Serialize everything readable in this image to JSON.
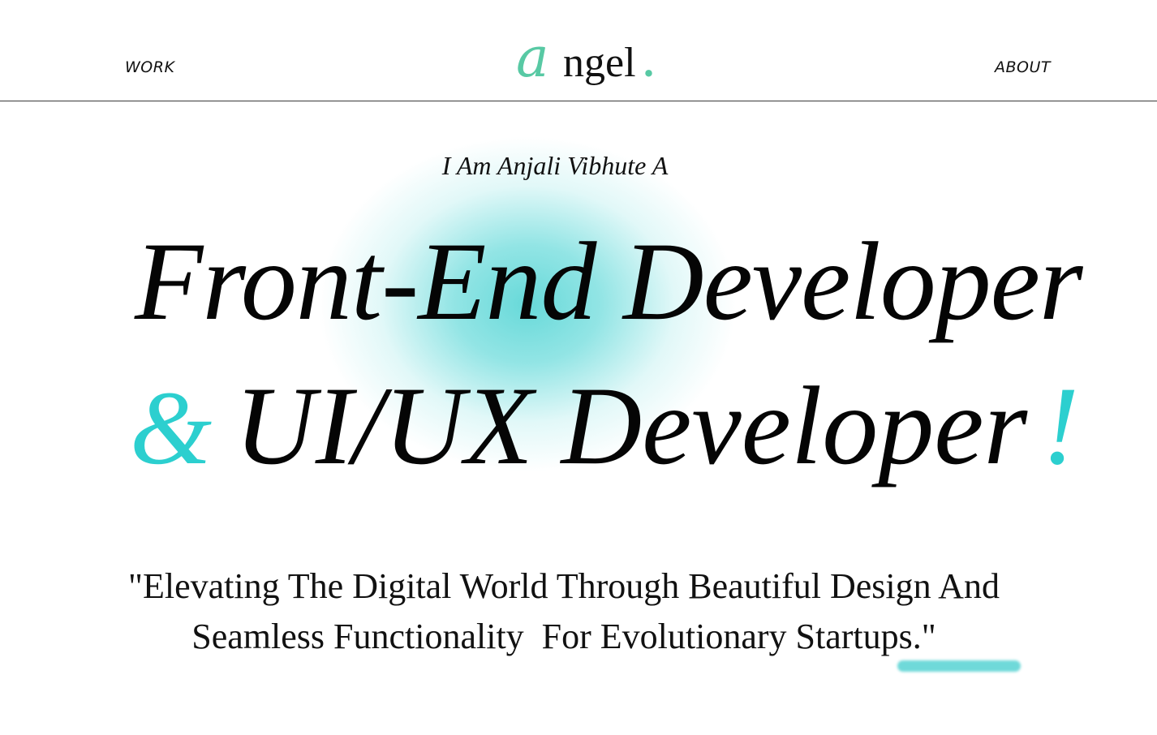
{
  "nav": {
    "left_link": "WORK",
    "right_link": "ABOUT"
  },
  "logo": {
    "initial": "a",
    "rest": "ngel",
    "dot": "."
  },
  "hero": {
    "intro": "I Am Anjali Vibhute A",
    "line1": "Front-End Developer",
    "ampersand": "&",
    "line2": "UI/UX Developer",
    "exclaim": "!",
    "tagline_line1": "\"Elevating The Digital World Through Beautiful Design And",
    "tagline_line2": "Seamless Functionality  For Evolutionary Startups.\""
  },
  "colors": {
    "logo_accent": "#58c9a4",
    "hero_accent": "#2ccfcf",
    "glow": "#6fd9d9",
    "text": "#0b0b0b",
    "background": "#ffffff"
  }
}
